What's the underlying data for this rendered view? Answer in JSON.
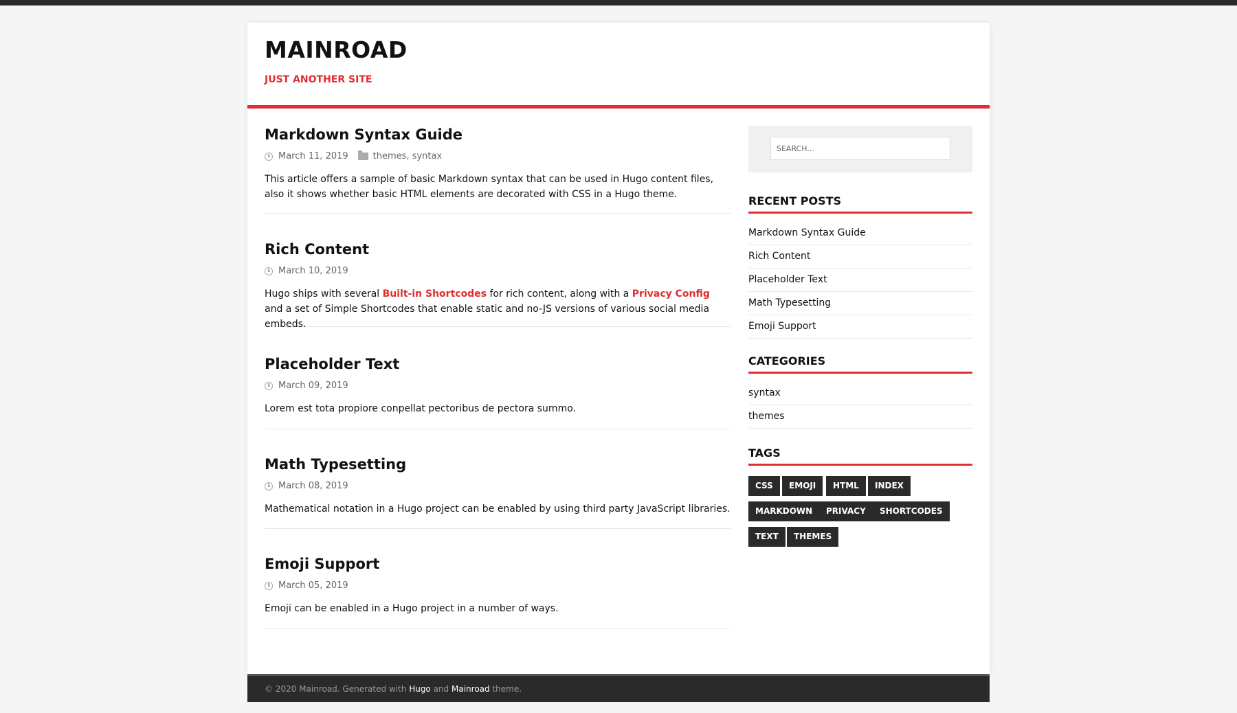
{
  "site": {
    "title": "MAINROAD",
    "tagline": "JUST ANOTHER SITE"
  },
  "posts": [
    {
      "title": "Markdown Syntax Guide",
      "date": "March 11, 2019",
      "categories": "themes, syntax",
      "excerpt": "This article offers a sample of basic Markdown syntax that can be used in Hugo content files, also it shows whether basic HTML elements are decorated with CSS in a Hugo theme."
    },
    {
      "title": "Rich Content",
      "date": "March 10, 2019",
      "excerpt_before": "Hugo ships with several ",
      "link1": "Built-in Shortcodes",
      "excerpt_mid": " for rich content, along with a ",
      "link2": "Privacy Config",
      "excerpt_after": " and a set of Simple Shortcodes that enable static and no-JS versions of various social media embeds."
    },
    {
      "title": "Placeholder Text",
      "date": "March 09, 2019",
      "excerpt": "Lorem est tota propiore conpellat pectoribus de pectora summo."
    },
    {
      "title": "Math Typesetting",
      "date": "March 08, 2019",
      "excerpt": "Mathematical notation in a Hugo project can be enabled by using third party JavaScript libraries."
    },
    {
      "title": "Emoji Support",
      "date": "March 05, 2019",
      "excerpt": "Emoji can be enabled in a Hugo project in a number of ways."
    }
  ],
  "sidebar": {
    "search_placeholder": "SEARCH...",
    "recent_title": "RECENT POSTS",
    "recent": [
      "Markdown Syntax Guide",
      "Rich Content",
      "Placeholder Text",
      "Math Typesetting",
      "Emoji Support"
    ],
    "categories_title": "CATEGORIES",
    "categories": [
      "syntax",
      "themes"
    ],
    "tags_title": "TAGS",
    "tags": [
      "CSS",
      "EMOJI",
      "HTML",
      "INDEX",
      "MARKDOWN",
      "PRIVACY",
      "SHORTCODES",
      "TEXT",
      "THEMES"
    ]
  },
  "footer": {
    "prefix": "© 2020 Mainroad. Generated with ",
    "hugo": "Hugo",
    "and": " and ",
    "mainroad": "Mainroad",
    "suffix": " theme."
  },
  "colors": {
    "accent": "#e22d30",
    "dark": "#2a2a2a"
  }
}
